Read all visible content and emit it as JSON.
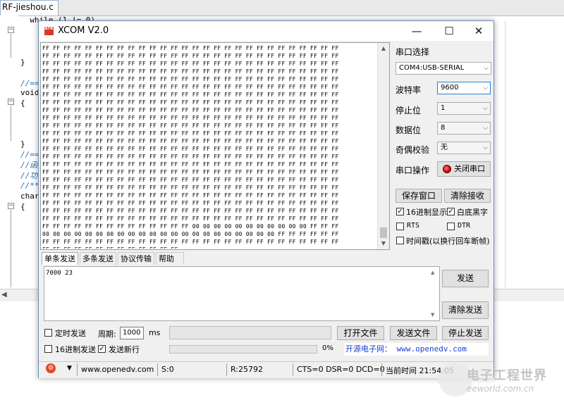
{
  "editor": {
    "tab": "RF-jieshou.c",
    "lines": [
      "  while (1 != 0)",
      "}",
      "//===",
      "void",
      "{",
      "}",
      "//===",
      "//函",
      "//功",
      "//***",
      "char",
      "{"
    ]
  },
  "window": {
    "title": "XCOM V2.0",
    "minimize": "—",
    "maximize": "☐",
    "close": "✕",
    "icon_text": "ATK"
  },
  "receive": {
    "row_ff": "FF FF FF FF FF FF FF FF FF FF FF FF FF FF FF FF FF FF FF FF FF FF FF FF FF FF FF FF",
    "row_mixed1": "FF FF FF FF FF FF FF FF FF FF FF FF FF FF 00 00 00 00 00 00 00 00 00 00 00 FF FF FF",
    "row_mixed2": "00 00 00 00 00 00 00 00 00 00 00 00 00 00 00 00 00 00 00 00 00 00 FF FF FF FF FF FF",
    "row_last": "FF FF FF FF FF FF FF FF FF FF FF FF FF"
  },
  "panel": {
    "port_label": "串口选择",
    "port_value": "COM4:USB-SERIAL",
    "baud_label": "波特率",
    "baud_value": "9600",
    "stop_label": "停止位",
    "stop_value": "1",
    "data_label": "数据位",
    "data_value": "8",
    "parity_label": "奇偶校验",
    "parity_value": "无",
    "op_label": "串口操作",
    "op_button": "关闭串口",
    "save_window": "保存窗口",
    "clear_recv": "清除接收",
    "hex_display": "16进制显示",
    "white_black": "白底黑字",
    "rts": "RTS",
    "dtr": "DTR",
    "timestamp": "时间戳(以换行回车断帧)"
  },
  "tabs": [
    "单条发送",
    "多条发送",
    "协议传输",
    "帮助"
  ],
  "send": {
    "text": "7000 23",
    "send_button": "发送",
    "clear_send": "清除发送",
    "timed_send": "定时发送",
    "period_label": "周期:",
    "period_value": "1000",
    "period_unit": "ms",
    "open_file": "打开文件",
    "send_file": "发送文件",
    "stop_send": "停止发送",
    "hex_send": "16进制发送",
    "send_newline": "发送新行",
    "progress": "0%",
    "ad": "开源电子网： www.openedv.com"
  },
  "status": {
    "url": "www.openedv.com",
    "s": "S:0",
    "r": "R:25792",
    "lines": "CTS=0 DSR=0 DCD=0",
    "time": "当前时间 21:54:05"
  },
  "watermark": {
    "cn": "电子工程世界",
    "en": "eeworld.com.cn"
  }
}
